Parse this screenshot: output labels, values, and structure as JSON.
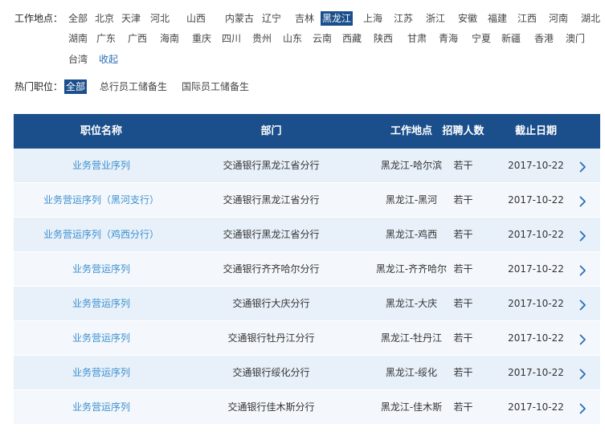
{
  "location_filter": {
    "label": "工作地点：",
    "items": [
      "全部",
      "北京",
      "天津",
      "河北",
      "山西",
      "内蒙古",
      "辽宁",
      "吉林",
      "黑龙江",
      "上海",
      "江苏",
      "浙江",
      "安徽",
      "福建",
      "江西",
      "河南",
      "湖北",
      "湖南",
      "广东",
      "广西",
      "海南",
      "重庆",
      "四川",
      "贵州",
      "山东",
      "云南",
      "西藏",
      "陕西",
      "甘肃",
      "青海",
      "宁夏",
      "新疆",
      "香港",
      "澳门",
      "台湾"
    ],
    "active": "黑龙江",
    "collapse_label": "收起"
  },
  "position_filter": {
    "label": "热门职位：",
    "items": [
      "全部",
      "总行员工储备生",
      "国际员工储备生"
    ],
    "active": "全部"
  },
  "table": {
    "headers": [
      "职位名称",
      "部门",
      "工作地点",
      "招聘人数",
      "截止日期"
    ],
    "rows": [
      {
        "name": "业务营业序列",
        "dept": "交通银行黑龙江省分行",
        "location": "黑龙江-哈尔滨",
        "count": "若干",
        "deadline": "2017-10-22"
      },
      {
        "name": "业务营运序列（黑河支行）",
        "dept": "交通银行黑龙江省分行",
        "location": "黑龙江-黑河",
        "count": "若干",
        "deadline": "2017-10-22"
      },
      {
        "name": "业务营运序列（鸡西分行）",
        "dept": "交通银行黑龙江省分行",
        "location": "黑龙江-鸡西",
        "count": "若干",
        "deadline": "2017-10-22"
      },
      {
        "name": "业务营运序列",
        "dept": "交通银行齐齐哈尔分行",
        "location": "黑龙江-齐齐哈尔",
        "count": "若干",
        "deadline": "2017-10-22"
      },
      {
        "name": "业务营运序列",
        "dept": "交通银行大庆分行",
        "location": "黑龙江-大庆",
        "count": "若干",
        "deadline": "2017-10-22"
      },
      {
        "name": "业务营运序列",
        "dept": "交通银行牡丹江分行",
        "location": "黑龙江-牡丹江",
        "count": "若干",
        "deadline": "2017-10-22"
      },
      {
        "name": "业务营运序列",
        "dept": "交通银行绥化分行",
        "location": "黑龙江-绥化",
        "count": "若干",
        "deadline": "2017-10-22"
      },
      {
        "name": "业务营运序列",
        "dept": "交通银行佳木斯分行",
        "location": "黑龙江-佳木斯",
        "count": "若干",
        "deadline": "2017-10-22"
      }
    ],
    "row_arrow_icon": "chevron-right-icon"
  },
  "colors": {
    "accent": "#1b4f8c",
    "link": "#3d8fcf",
    "row_alt_a": "#e8f1fa",
    "row_alt_b": "#f4f8fc"
  }
}
